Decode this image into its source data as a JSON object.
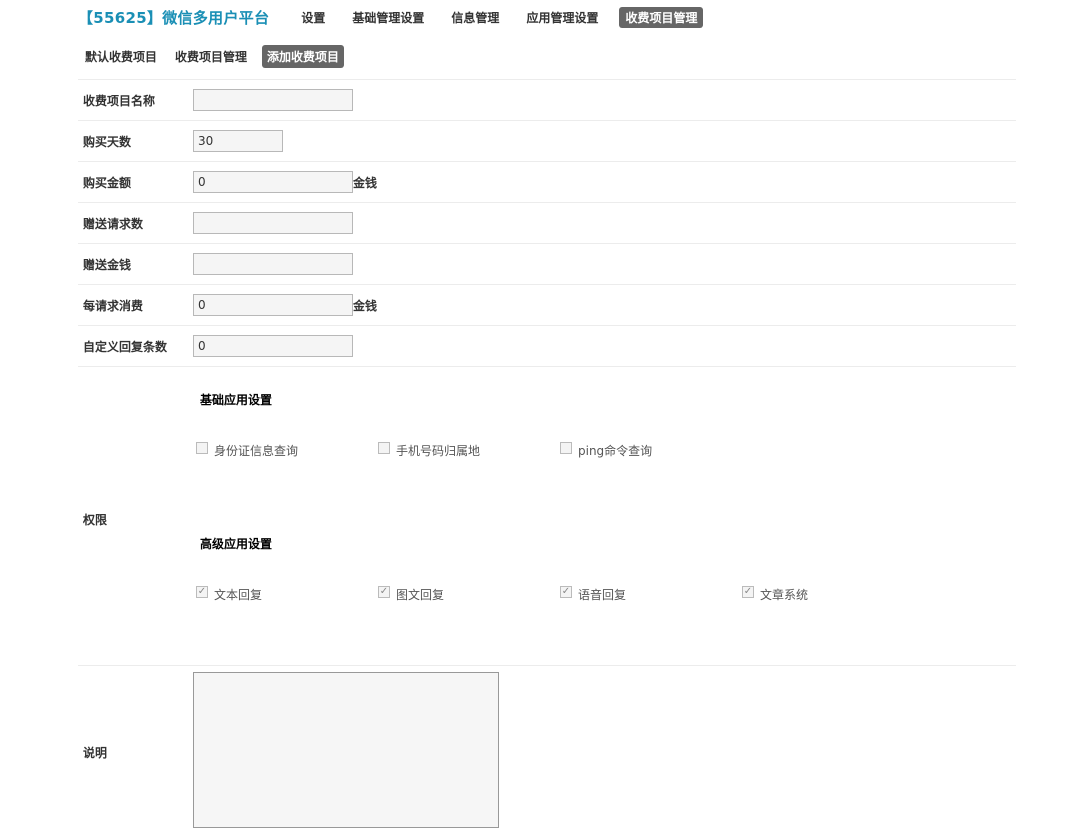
{
  "header": {
    "brand": "【55625】微信多用户平台",
    "nav": [
      {
        "label": "设置",
        "active": false
      },
      {
        "label": "基础管理设置",
        "active": false
      },
      {
        "label": "信息管理",
        "active": false
      },
      {
        "label": "应用管理设置",
        "active": false
      },
      {
        "label": "收费项目管理",
        "active": true
      }
    ]
  },
  "subnav": [
    {
      "label": "默认收费项目",
      "active": false
    },
    {
      "label": "收费项目管理",
      "active": false
    },
    {
      "label": "添加收费项目",
      "active": true
    }
  ],
  "form": {
    "name": {
      "label": "收费项目名称",
      "value": ""
    },
    "days": {
      "label": "购买天数",
      "value": "30"
    },
    "amount": {
      "label": "购买金额",
      "value": "0",
      "unit": "金钱"
    },
    "gift_requests": {
      "label": "赠送请求数",
      "value": ""
    },
    "gift_money": {
      "label": "赠送金钱",
      "value": ""
    },
    "per_request_cost": {
      "label": "每请求消费",
      "value": "0",
      "unit": "金钱"
    },
    "custom_replies": {
      "label": "自定义回复条数",
      "value": "0"
    },
    "permissions": {
      "label": "权限",
      "basic": {
        "title": "基础应用设置",
        "items": [
          {
            "label": "身份证信息查询",
            "checked": false
          },
          {
            "label": "手机号码归属地",
            "checked": false
          },
          {
            "label": "ping命令查询",
            "checked": false
          }
        ]
      },
      "advanced": {
        "title": "高级应用设置",
        "items": [
          {
            "label": "文本回复",
            "checked": true
          },
          {
            "label": "图文回复",
            "checked": true
          },
          {
            "label": "语音回复",
            "checked": true
          },
          {
            "label": "文章系统",
            "checked": true
          }
        ]
      }
    },
    "description": {
      "label": "说明",
      "value": ""
    }
  }
}
